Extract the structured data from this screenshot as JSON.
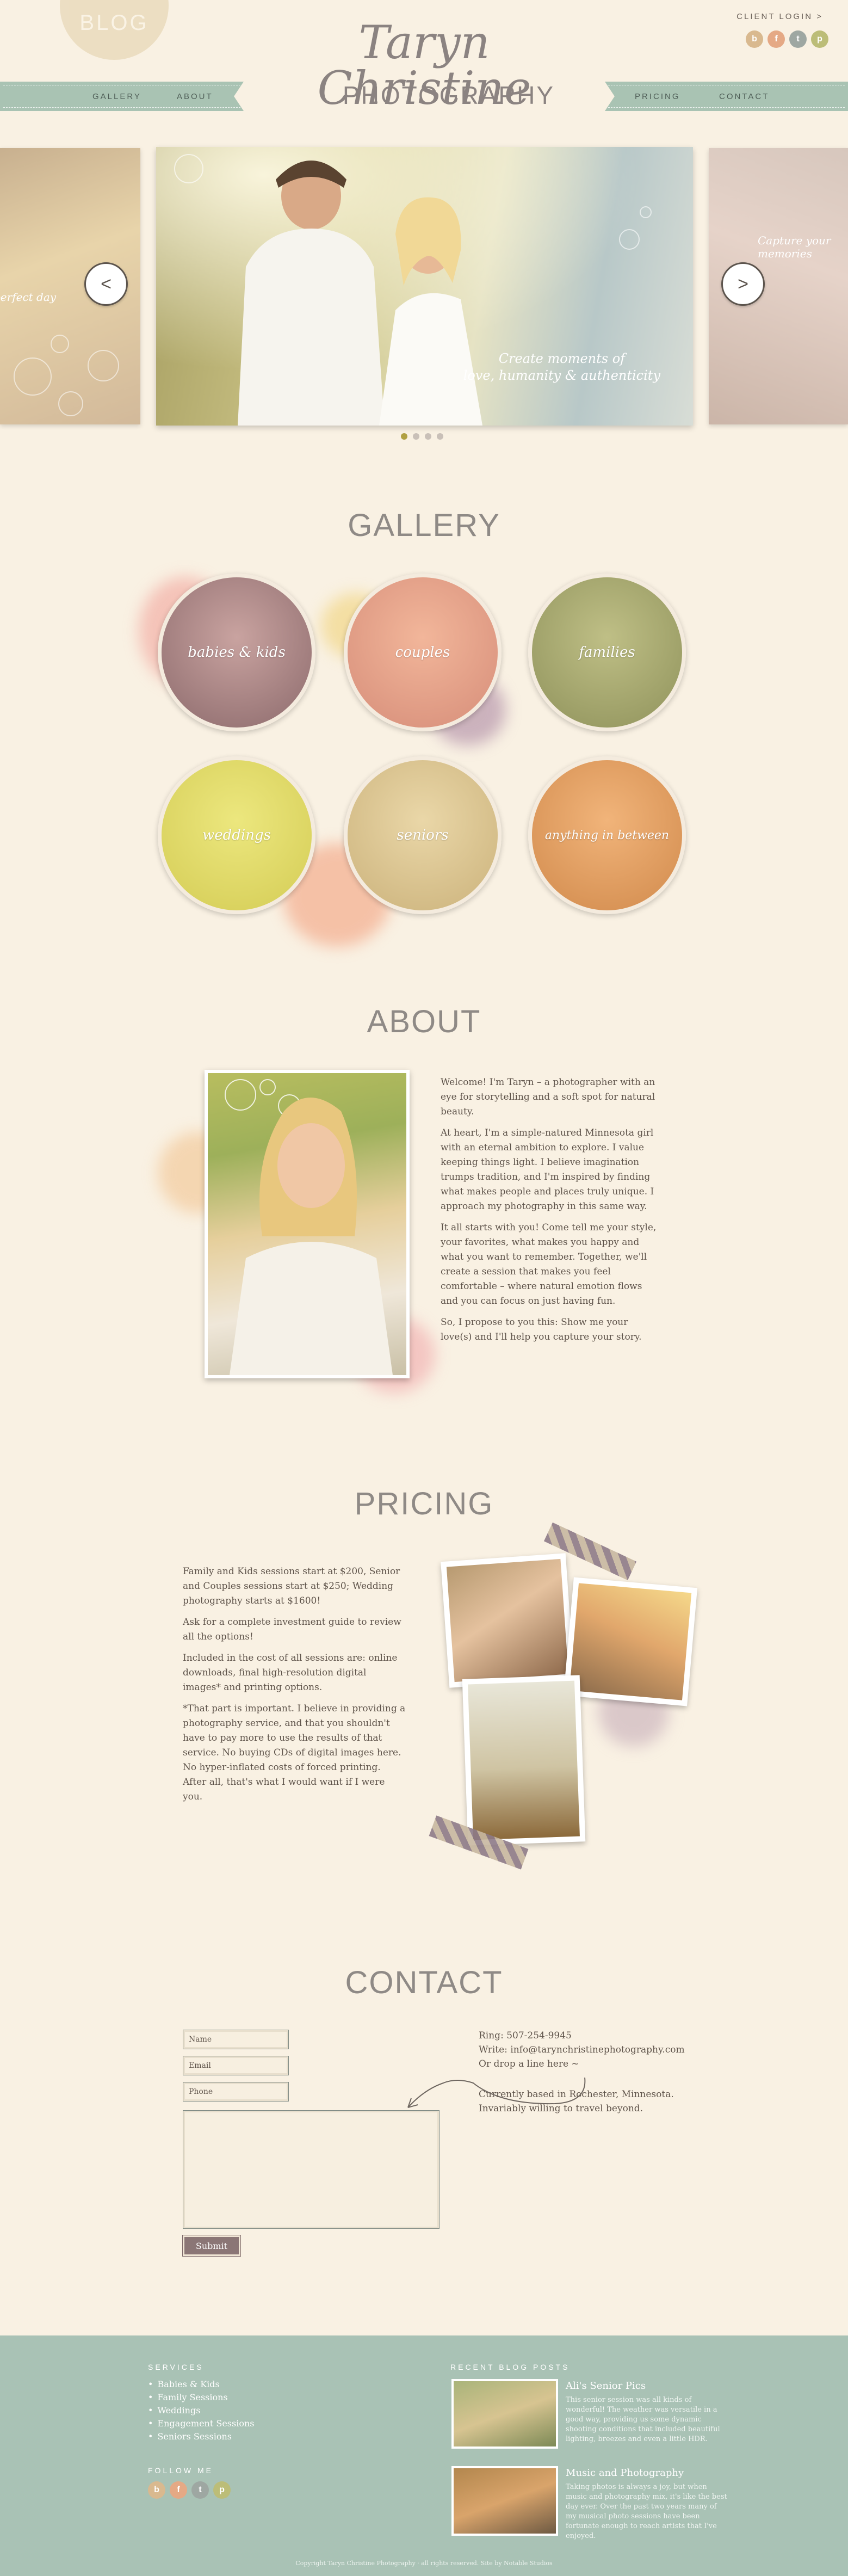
{
  "header": {
    "blog_label": "BLOG",
    "client_login": "CLIENT LOGIN >",
    "logo_script": "Taryn Christine",
    "logo_sub": "PHOTOGRAPHY",
    "nav_left": [
      "GALLERY",
      "ABOUT"
    ],
    "nav_right": [
      "PRICING",
      "CONTACT"
    ],
    "social_icons": [
      "blog-icon",
      "facebook-icon",
      "twitter-icon",
      "pinterest-icon"
    ]
  },
  "slider": {
    "left_caption": "perfect day",
    "main_caption_line1": "Create moments of",
    "main_caption_line2": "love, humanity & authenticity",
    "right_caption": "Capture your memories",
    "prev": "<",
    "next": ">"
  },
  "gallery": {
    "title": "GALLERY",
    "items": [
      "babies & kids",
      "couples",
      "families",
      "weddings",
      "seniors",
      "anything in between"
    ]
  },
  "about": {
    "title": "ABOUT",
    "paragraphs": [
      "Welcome! I'm Taryn – a photographer with an eye for storytelling and a soft spot for natural beauty.",
      "At heart, I'm a simple-natured Minnesota girl with an eternal ambition to explore. I value keeping things light. I believe imagination trumps tradition, and I'm inspired by finding what makes people and places truly unique. I approach my photography in this same way.",
      "It all starts with you! Come tell me your style, your favorites, what makes you happy and what you want to remember. Together, we'll create a session that makes you feel comfortable – where natural emotion flows and you can focus on just having fun.",
      "So, I propose to you this: Show me your love(s) and I'll help you capture your story."
    ]
  },
  "pricing": {
    "title": "PRICING",
    "paragraphs": [
      "Family and Kids sessions start at $200, Senior and Couples sessions start at $250; Wedding photography starts at $1600!",
      "Ask for a complete investment guide to review all the options!",
      "Included in the cost of all sessions are: online downloads, final high-resolution digital images* and printing options.",
      "*That part is important. I believe in providing a photography service, and that you shouldn't have to pay more to use the results of that service. No buying CDs of digital images here. No hyper-inflated costs of forced printing. After all, that's what I would want if I were you."
    ]
  },
  "contact": {
    "title": "CONTACT",
    "name_placeholder": "Name",
    "email_placeholder": "Email",
    "phone_placeholder": "Phone",
    "submit_label": "Submit",
    "ring": "Ring: 507-254-9945",
    "write": "Write: info@tarynchristinephotography.com",
    "drop": "Or drop a line here ~",
    "based_line1": "Currently based in Rochester, Minnesota.",
    "based_line2": "Invariably willing to travel beyond."
  },
  "footer": {
    "services_title": "SERVICES",
    "services": [
      "Babies & Kids",
      "Family Sessions",
      "Weddings",
      "Engagement Sessions",
      "Seniors Sessions"
    ],
    "follow_title": "FOLLOW ME",
    "blog_title": "RECENT BLOG POSTS",
    "posts": [
      {
        "title": "Ali's Senior Pics",
        "body": "This senior session was all kinds of wonderful! The weather was versatile in a good way, providing us some dynamic shooting conditions that included beautiful lighting, breezes and even a little HDR."
      },
      {
        "title": "Music and Photography",
        "body": "Taking photos is always a joy, but when music and photography mix, it's like the best day ever. Over the past two years many of my musical photo sessions have been fortunate enough to reach artists that I've enjoyed."
      }
    ],
    "copyright": "Copyright Taryn Christine Photography · all rights reserved. Site by Notable Studios"
  },
  "colors": {
    "background": "#f9f1e3",
    "ribbon": "#a9c3b3",
    "footer": "#a9c2b5",
    "heading": "#8f8a86",
    "submit": "#8b7676"
  }
}
